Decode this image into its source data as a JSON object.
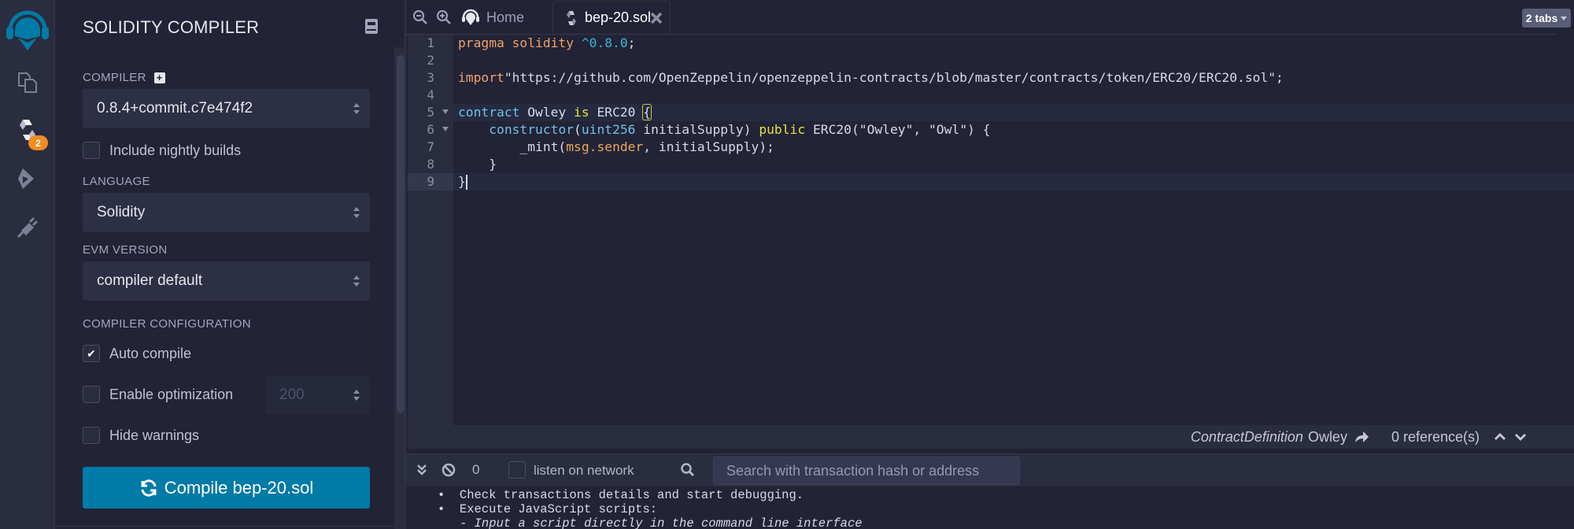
{
  "icon_panel": {
    "logo": "remix-logo",
    "items": [
      {
        "name": "file-explorers",
        "icon": "files-icon"
      },
      {
        "name": "solidity-compiler",
        "icon": "solidity-icon",
        "badge": "2",
        "active": true
      },
      {
        "name": "deploy-run",
        "icon": "ethereum-deploy-icon"
      },
      {
        "name": "plugin-manager",
        "icon": "plug-icon"
      }
    ],
    "colors": {
      "badge": "#f28b22",
      "logo": "#007aa6"
    }
  },
  "side_panel": {
    "title": "SOLIDITY COMPILER",
    "compiler_label": "COMPILER",
    "compiler_value": "0.8.4+commit.c7e474f2",
    "include_nightly_label": "Include nightly builds",
    "include_nightly_checked": false,
    "language_label": "LANGUAGE",
    "language_value": "Solidity",
    "evm_label": "EVM VERSION",
    "evm_value": "compiler default",
    "config_label": "COMPILER CONFIGURATION",
    "auto_compile_label": "Auto compile",
    "auto_compile_checked": true,
    "enable_optimization_label": "Enable optimization",
    "enable_optimization_checked": false,
    "optimization_runs": "200",
    "hide_warnings_label": "Hide warnings",
    "hide_warnings_checked": false,
    "compile_button": "Compile bep-20.sol",
    "checkmark": "✔",
    "colors": {
      "compile_button": "#007aa6"
    }
  },
  "tabs": {
    "home_label": "Home",
    "active_tab_label": "bep-20.sol",
    "tabs_dropdown": "2 tabs"
  },
  "editor": {
    "line_numbers": [
      "1",
      "2",
      "3",
      "4",
      "5",
      "6",
      "7",
      "8",
      "9"
    ],
    "lines": {
      "l1": {
        "kw": "pragma solidity ",
        "ver": "^0.8.0",
        "end": ";"
      },
      "l3": {
        "kw": "import",
        "str": "\"https://github.com/OpenZeppelin/openzeppelin-contracts/blob/master/contracts/token/ERC20/ERC20.sol\";"
      },
      "l5": {
        "kw": "contract",
        "name": " Owley ",
        "is": "is",
        "base": " ERC20 ",
        "brace": "{"
      },
      "l6": {
        "indent": "    ",
        "ctor": "constructor",
        "p1": "(",
        "type": "uint256",
        "rest1": " initialSupply) ",
        "pub": "public",
        "rest2": " ERC20(\"Owley\", \"Owl\") {"
      },
      "l7": {
        "indent": "        ",
        "fn": "_mint(",
        "arg": "msg.sender",
        "rest": ", initialSupply);"
      },
      "l8": {
        "text": "    }"
      },
      "l9": {
        "text": "}"
      }
    }
  },
  "context_bar": {
    "kind": "ContractDefinition",
    "name": "Owley",
    "references": "0 reference(s)"
  },
  "terminal": {
    "pending_count": "0",
    "listen_label": "listen on network",
    "listen_checked": false,
    "search_placeholder": "Search with transaction hash or address",
    "lines": [
      "•  Check transactions details and start debugging.",
      "•  Execute JavaScript scripts:",
      "- Input a script directly in the command line interface"
    ]
  }
}
